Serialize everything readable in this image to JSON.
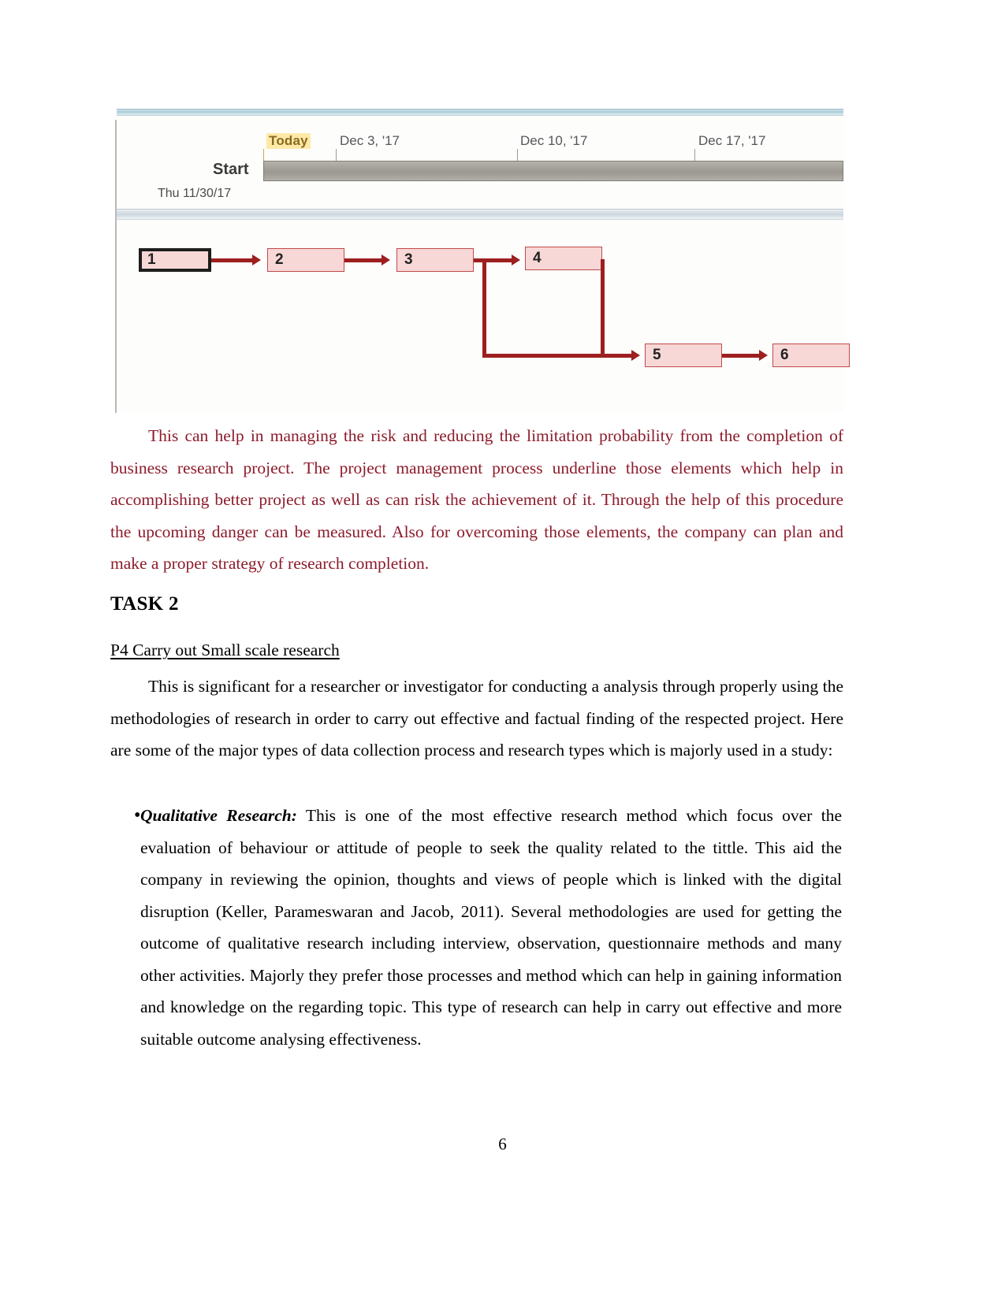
{
  "figure": {
    "name": "ms-project-gantt-and-network-diagram",
    "timeline": {
      "today_label": "Today",
      "dates": [
        "Dec 3, '17",
        "Dec 10, '17",
        "Dec 17, '17"
      ],
      "start_label": "Start",
      "start_date": "Thu 11/30/17"
    },
    "network": {
      "nodes": [
        {
          "id": "1",
          "label": "1",
          "critical": true
        },
        {
          "id": "2",
          "label": "2",
          "critical": false
        },
        {
          "id": "3",
          "label": "3",
          "critical": false
        },
        {
          "id": "4",
          "label": "4",
          "critical": false
        },
        {
          "id": "5",
          "label": "5",
          "critical": false
        },
        {
          "id": "6",
          "label": "6",
          "critical": false
        }
      ],
      "links": [
        {
          "from": "1",
          "to": "2"
        },
        {
          "from": "2",
          "to": "3"
        },
        {
          "from": "3",
          "to": "4"
        },
        {
          "from": "3",
          "to": "5"
        },
        {
          "from": "4",
          "to": "5"
        },
        {
          "from": "5",
          "to": "6"
        }
      ]
    },
    "colors": {
      "node_fill": "#f8d7d7",
      "node_border": "#c04a4a",
      "connector": "#9d1f1f",
      "today_highlight": "#ffe9a8",
      "bar_fill": "#9a9790"
    }
  },
  "body": {
    "paragraph_1": "This can help in managing the risk and reducing the limitation probability from the completion of business research project. The project management process underline those elements which help in accomplishing better project as well as can risk the achievement of it. Through the help of this procedure the upcoming danger can be measured. Also for overcoming those elements, the company can plan and make a proper strategy of research completion.",
    "paragraph_1_color": "#8c1b2b",
    "task_heading": "TASK 2",
    "sub_heading": "P4 Carry out Small scale research",
    "paragraph_2": "This is significant for a researcher or investigator for conducting a analysis through properly using the methodologies of research in order to carry out effective and factual finding of the respected project. Here are some of the major types of data collection process and research types which is majorly used in a study:",
    "bullets": [
      {
        "marker": "•",
        "term": "Qualitative Research:",
        "text": " This is one of the most effective research method which focus over the evaluation of behaviour or attitude of people to seek the quality related to the tittle. This aid the company in reviewing the opinion, thoughts and views of people which is linked with the digital disruption (Keller, Parameswaran and Jacob, 2011). Several methodologies are used for getting the outcome of qualitative research including interview, observation, questionnaire methods and many other activities. Majorly they prefer those processes and method which can help in gaining information and knowledge on the regarding topic. This type of research can help in carry out effective and more suitable outcome analysing effectiveness."
      }
    ]
  },
  "footer": {
    "page_number": "6"
  }
}
